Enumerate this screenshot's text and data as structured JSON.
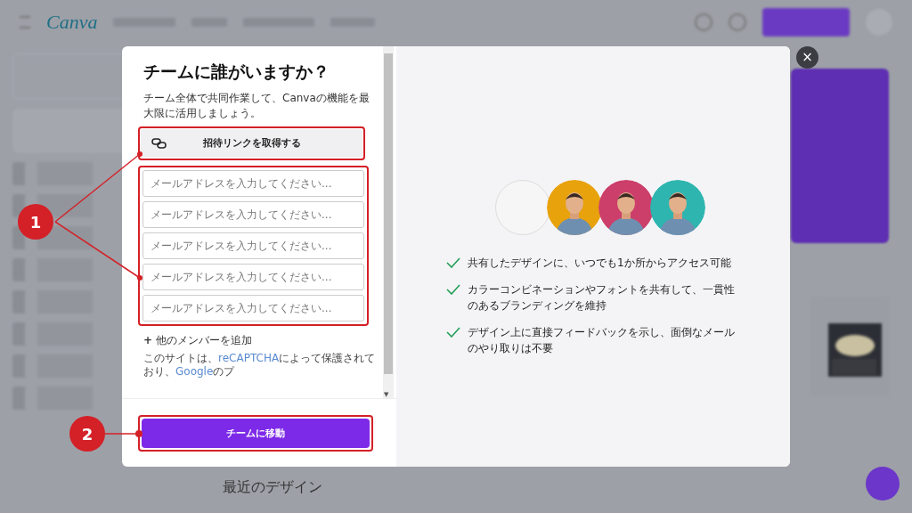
{
  "background": {
    "logo": "Canva",
    "recent_heading": "最近のデザイン"
  },
  "dialog": {
    "title": "チームに誰がいますか？",
    "description": "チーム全体で共同作業して、Canvaの機能を最大限に活用しましょう。",
    "invite_link_button": "招待リンクを取得する",
    "email_fields": [
      {
        "placeholder": "メールアドレスを入力してください..."
      },
      {
        "placeholder": "メールアドレスを入力してください..."
      },
      {
        "placeholder": "メールアドレスを入力してください..."
      },
      {
        "placeholder": "メールアドレスを入力してください..."
      },
      {
        "placeholder": "メールアドレスを入力してください..."
      }
    ],
    "add_member": {
      "icon": "+",
      "label": "他のメンバーを追加"
    },
    "recaptcha_notice": [
      {
        "kind": "text",
        "text": "このサイトは、"
      },
      {
        "kind": "link",
        "text": "reCAPTCHA"
      },
      {
        "kind": "text",
        "text": "によって保護されており、"
      },
      {
        "kind": "link",
        "text": "Google"
      },
      {
        "kind": "text",
        "text": "のプ"
      }
    ],
    "scroll_arrow": "▼",
    "submit_button": "チームに移動",
    "close": "×",
    "avatars": [
      {
        "kind": "empty"
      },
      {
        "kind": "picture",
        "color": "#e8a20c"
      },
      {
        "kind": "picture",
        "color": "#cc3f6a"
      },
      {
        "kind": "picture",
        "color": "#2fb5b0"
      }
    ],
    "features": [
      "共有したデザインに、いつでも1か所からアクセス可能",
      "カラーコンビネーションやフォントを共有して、一貫性のあるブランディングを維持",
      "デザイン上に直接フィードバックを示し、面倒なメールのやり取りは不要"
    ]
  },
  "annotations": [
    {
      "number": "1"
    },
    {
      "number": "2"
    }
  ]
}
